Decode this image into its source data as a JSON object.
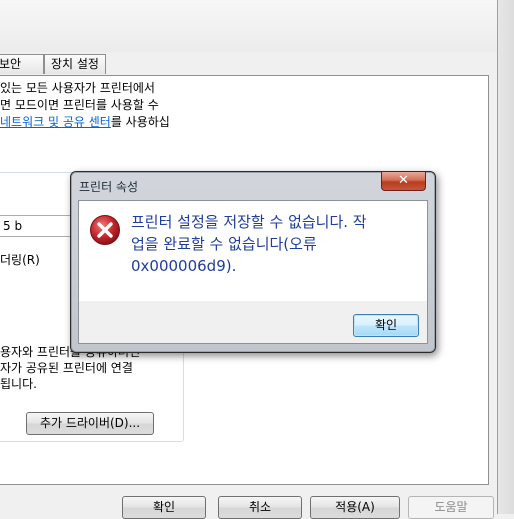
{
  "properties": {
    "tabs": [
      "보안",
      "장치 설정"
    ],
    "sharing_text": [
      "있는 모든 사용자가 프린터에서",
      "면 모드이면 프린터를 사용할 수"
    ],
    "link_text": "네트워크 및 공유 센터",
    "link_suffix": "를 사용하십",
    "share_name_value": "5 b",
    "render_label": "더링(R)",
    "drivers_text": [
      "용자와 프린터를 공유하려면",
      "자가 공유된 프린터에 연결",
      "됩니다."
    ],
    "add_driver_button": "추가 드라이버(D)..."
  },
  "footer_buttons": {
    "ok": "확인",
    "cancel": "취소",
    "apply": "적용(A)",
    "help": "도움말"
  },
  "dialog": {
    "title": "프린터 속성",
    "close_glyph": "✕",
    "icon": "error-icon",
    "message_lines": [
      "프린터 설정을 저장할 수 없습니다. 작",
      "업을 완료할 수 없습니다(오류",
      "0x000006d9)."
    ],
    "ok_button": "확인"
  },
  "colors": {
    "message_text": "#1f3d9b",
    "link": "#0066cc",
    "error_red": "#c4262e"
  }
}
